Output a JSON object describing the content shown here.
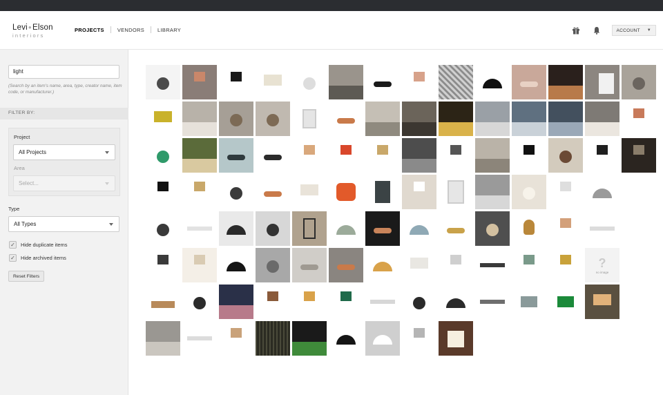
{
  "brand": {
    "name_left": "Levi",
    "name_right": "Elson",
    "sub": "interiors"
  },
  "nav": {
    "items": [
      {
        "label": "PROJECTS",
        "active": true
      },
      {
        "label": "VENDORS",
        "active": false
      },
      {
        "label": "LIBRARY",
        "active": false
      }
    ]
  },
  "header": {
    "account_label": "ACCOUNT",
    "icons": [
      "gift-icon",
      "bell-icon"
    ]
  },
  "sidebar": {
    "search_value": "light",
    "search_hint": "(Search by an item's name, area, type, creator name, item code, or manufacturer.)",
    "filter_by_label": "FILTER BY:",
    "project_label": "Project",
    "project_value": "All Projects",
    "area_label": "Area",
    "area_placeholder": "Select...",
    "type_label": "Type",
    "type_value": "All Types",
    "hide_duplicates_label": "Hide duplicate items",
    "hide_archived_label": "Hide archived items",
    "reset_label": "Reset Filters"
  },
  "no_image": {
    "mark": "?",
    "label": "no image"
  },
  "items": [
    [
      "#f4f4f4",
      "#4b4b4b",
      "pendant"
    ],
    [
      "#8a7d77",
      "#c9876a",
      "lamp"
    ],
    [
      "#ffffff",
      "#1a1a1a",
      "lamp"
    ],
    [
      "#ffffff",
      "#e8e2d2",
      "drum"
    ],
    [
      "#ffffff",
      "#dddddd",
      "pendant"
    ],
    [
      "#9a948c",
      "#5d5a54",
      "room"
    ],
    [
      "#ffffff",
      "#1a1a1a",
      "cluster"
    ],
    [
      "#ffffff",
      "#d7a28a",
      "lamp"
    ],
    [
      "#8c8c8c",
      "#cfcfcf",
      "stripes"
    ],
    [
      "#ffffff",
      "#111111",
      "dome"
    ],
    [
      "#c9a89a",
      "#e8d1c4",
      "cluster"
    ],
    [
      "#2a201c",
      "#b87a4a",
      "room"
    ],
    [
      "#8c8680",
      "#f1f1f1",
      "stairs"
    ],
    [
      "#a9a39a",
      "#6b655f",
      "pendant"
    ],
    [
      "#ffffff",
      "#c9b22b",
      "drum"
    ],
    [
      "#b8b2a9",
      "#e6e1da",
      "room"
    ],
    [
      "#a69f96",
      "#7c6a55",
      "pendant"
    ],
    [
      "#c0b9b0",
      "#7d6a55",
      "pendant"
    ],
    [
      "#ffffff",
      "#e5e5e5",
      "chair"
    ],
    [
      "#ffffff",
      "#c97a4a",
      "cluster"
    ],
    [
      "#c5bfb5",
      "#8f8a7f",
      "room"
    ],
    [
      "#6b645a",
      "#3c3731",
      "room"
    ],
    [
      "#2c2416",
      "#d9b24a",
      "room"
    ],
    [
      "#9aa0a6",
      "#d7d7d7",
      "room"
    ],
    [
      "#5f7080",
      "#c9d1d8",
      "room"
    ],
    [
      "#43505e",
      "#9aa8b7",
      "room"
    ],
    [
      "#7e7a75",
      "#ebe6df",
      "room"
    ],
    [
      "#ffffff",
      "#c87a5a",
      "lamp"
    ],
    [
      "#ffffff",
      "#2f9a6a",
      "pendant"
    ],
    [
      "#5b6b3a",
      "#d9c9a0",
      "room"
    ],
    [
      "#b5c7c9",
      "#2f3a3d",
      "cluster"
    ],
    [
      "#ffffff",
      "#2b2b2b",
      "cluster"
    ],
    [
      "#ffffff",
      "#d9a87c",
      "lamp"
    ],
    [
      "#ffffff",
      "#d9472b",
      "lamp"
    ],
    [
      "#ffffff",
      "#c9a86a",
      "lamp"
    ],
    [
      "#4d4d4d",
      "#8a8a8a",
      "room"
    ],
    [
      "#ffffff",
      "#555555",
      "lamp"
    ],
    [
      "#bab3a8",
      "#8c857a",
      "room"
    ],
    [
      "#ffffff",
      "#111111",
      "lamp"
    ],
    [
      "#d3cbbd",
      "#6b4a35",
      "pendant"
    ],
    [
      "#ffffff",
      "#1f1f1f",
      "lamp"
    ],
    [
      "#2b2520",
      "#8a7d6a",
      "lamp"
    ],
    [
      "#ffffff",
      "#111111",
      "lamp"
    ],
    [
      "#ffffff",
      "#c9a86a",
      "lamp"
    ],
    [
      "#ffffff",
      "#3a3a3a",
      "pendant"
    ],
    [
      "#ffffff",
      "#c97a4a",
      "cluster"
    ],
    [
      "#ffffff",
      "#e9e3d9",
      "drum"
    ],
    [
      "#ffffff",
      "#e25a2a",
      "bag"
    ],
    [
      "#ffffff",
      "#3b4345",
      "cabinet"
    ],
    [
      "#e0d9cf",
      "#ffffff",
      "lamp"
    ],
    [
      "#ffffff",
      "#e6e6e6",
      "shelf"
    ],
    [
      "#9a9a9a",
      "#d7d7d7",
      "room"
    ],
    [
      "#e8e2d8",
      "#f7f3ea",
      "pendant"
    ],
    [
      "#ffffff",
      "#dedede",
      "lamp"
    ],
    [
      "#ffffff",
      "#9a9a9a",
      "dome"
    ],
    [
      "#ffffff",
      "#ffffff",
      "blank"
    ],
    [
      "#ffffff",
      "#3a3a3a",
      "pendant"
    ],
    [
      "#ffffff",
      "#e2e2e2",
      "bar"
    ],
    [
      "#e9e9e9",
      "#2a2a2a",
      "dome"
    ],
    [
      "#d7d7d7",
      "#333333",
      "pendant"
    ],
    [
      "#b0a28e",
      "#2c2c2c",
      "lantern"
    ],
    [
      "#ffffff",
      "#9cab9a",
      "dome"
    ],
    [
      "#1a1a1a",
      "#c9845a",
      "cluster"
    ],
    [
      "#ffffff",
      "#8fa9b5",
      "dome"
    ],
    [
      "#ffffff",
      "#c9a24a",
      "cluster"
    ],
    [
      "#4f4f4f",
      "#d3c0a0",
      "pendant"
    ],
    [
      "#ffffff",
      "#b9873a",
      "bulb"
    ],
    [
      "#ffffff",
      "#d3a07a",
      "lamp"
    ],
    [
      "#ffffff",
      "#dcdcdc",
      "bar"
    ],
    [
      "#ffffff",
      "#ffffff",
      "blank"
    ],
    [
      "#ffffff",
      "#3a3a3a",
      "lamp"
    ],
    [
      "#f4efe7",
      "#d9cbb3",
      "lamp"
    ],
    [
      "#ffffff",
      "#151515",
      "dome"
    ],
    [
      "#a8a8a8",
      "#6a6a6a",
      "pendant"
    ],
    [
      "#d0cdc8",
      "#9f9a92",
      "cluster"
    ],
    [
      "#8a8580",
      "#c97a4a",
      "cluster"
    ],
    [
      "#ffffff",
      "#d9a24a",
      "dome"
    ],
    [
      "#ffffff",
      "#e9e7e2",
      "drum"
    ],
    [
      "#ffffff",
      "#cfcfcf",
      "lamp"
    ],
    [
      "#ffffff",
      "#3a3a3a",
      "bar"
    ],
    [
      "#ffffff",
      "#7a9a8a",
      "lamp"
    ],
    [
      "#ffffff",
      "#c9a23a",
      "lamp"
    ],
    [
      "NOIMG",
      "NOIMG",
      "noimg"
    ],
    [
      "#ffffff",
      "#b88a5a",
      "bed"
    ],
    [
      "#ffffff",
      "#2b2b2b",
      "pendant"
    ],
    [
      "#2a3048",
      "#b77a8a",
      "room"
    ],
    [
      "#ffffff",
      "#8a5a3a",
      "lamp"
    ],
    [
      "#ffffff",
      "#d9a24a",
      "lamp"
    ],
    [
      "#ffffff",
      "#1f6a4a",
      "lamp"
    ],
    [
      "#ffffff",
      "#d7d7d7",
      "bar"
    ],
    [
      "#ffffff",
      "#2a2a2a",
      "pendant"
    ],
    [
      "#ffffff",
      "#2b2b2b",
      "dome"
    ],
    [
      "#ffffff",
      "#6e6e6e",
      "bar"
    ],
    [
      "#ffffff",
      "#8a9a9a",
      "exit"
    ],
    [
      "#ffffff",
      "#1b8a3a",
      "exit"
    ],
    [
      "#5a5040",
      "#e2b27a",
      "drum"
    ],
    [
      "#9a9792",
      "#cac6bf",
      "room"
    ],
    [
      "#ffffff",
      "#dcdcdc",
      "bar"
    ],
    [
      "#ffffff",
      "#c9a27a",
      "lamp"
    ],
    [
      "#2b2b22",
      "#4a4a3a",
      "texture"
    ],
    [
      "#1a1a1a",
      "#3f8a3a",
      "room"
    ],
    [
      "#ffffff",
      "#151515",
      "dome"
    ],
    [
      "#cfcfcf",
      "#ffffff",
      "dome"
    ],
    [
      "#ffffff",
      "#b5b5b5",
      "lamp"
    ],
    [
      "#5a3a2a",
      "#f6efe0",
      "cube"
    ]
  ]
}
